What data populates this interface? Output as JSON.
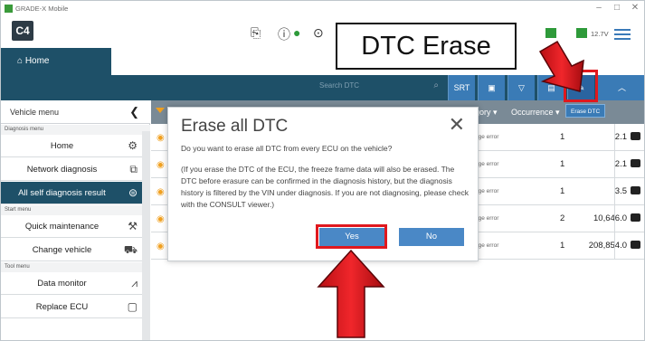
{
  "window": {
    "title": "GRADE-X Mobile",
    "minimize": "–",
    "maximize": "□",
    "close": "✕"
  },
  "toolbar": {
    "app_badge": "C4",
    "voltage": "12.7V"
  },
  "callout": {
    "text": "DTC Erase"
  },
  "home": {
    "label": "⌂ Home"
  },
  "search": {
    "placeholder": "Search DTC"
  },
  "band_buttons": {
    "srt": "SRT"
  },
  "sidebar": {
    "header": "Vehicle menu",
    "sections": {
      "diagnosis": "Diagnosis menu",
      "start": "Start menu",
      "tool": "Tool menu"
    },
    "items": [
      {
        "label": "Home",
        "icon": "gear-icon"
      },
      {
        "label": "Network diagnosis",
        "icon": "network-icon"
      },
      {
        "label": "All self diagnosis result",
        "icon": "car-search-icon"
      },
      {
        "label": "Quick maintenance",
        "icon": "wrench-icon"
      },
      {
        "label": "Change vehicle",
        "icon": "car-icon"
      },
      {
        "label": "Data monitor",
        "icon": "waveform-icon"
      },
      {
        "label": "Replace ECU",
        "icon": "ecu-icon"
      }
    ]
  },
  "table": {
    "category_header": "gory ▾",
    "occurrence_header": "Occurrence ▾",
    "erase_tooltip": "Erase DTC",
    "rows": [
      {
        "category": "age error",
        "count": "1",
        "occurrence": "2.1"
      },
      {
        "category": "age error",
        "count": "1",
        "occurrence": "2.1"
      },
      {
        "category": "age error",
        "count": "1",
        "occurrence": "3.5"
      },
      {
        "category": "age error",
        "count": "2",
        "occurrence": "10,646.0"
      },
      {
        "category": "age error",
        "count": "1",
        "occurrence": "208,854.0"
      }
    ]
  },
  "dialog": {
    "title": "Erase all DTC",
    "question": "Do you want to erase all DTC from every ECU on the vehicle?",
    "note": "(If you erase the DTC of the ECU, the freeze frame data will also be erased. The DTC before erasure can be confirmed in the diagnosis history, but the diagnosis history is filtered by the VIN under diagnosis. If you are not diagnosing, please check with the CONSULT viewer.)",
    "yes_label": "Yes",
    "no_label": "No"
  },
  "colors": {
    "header_band": "#1e5068",
    "accent_blue": "#3a7bb6",
    "highlight_red": "#e0181e",
    "arrow_red": "#e0181e"
  }
}
